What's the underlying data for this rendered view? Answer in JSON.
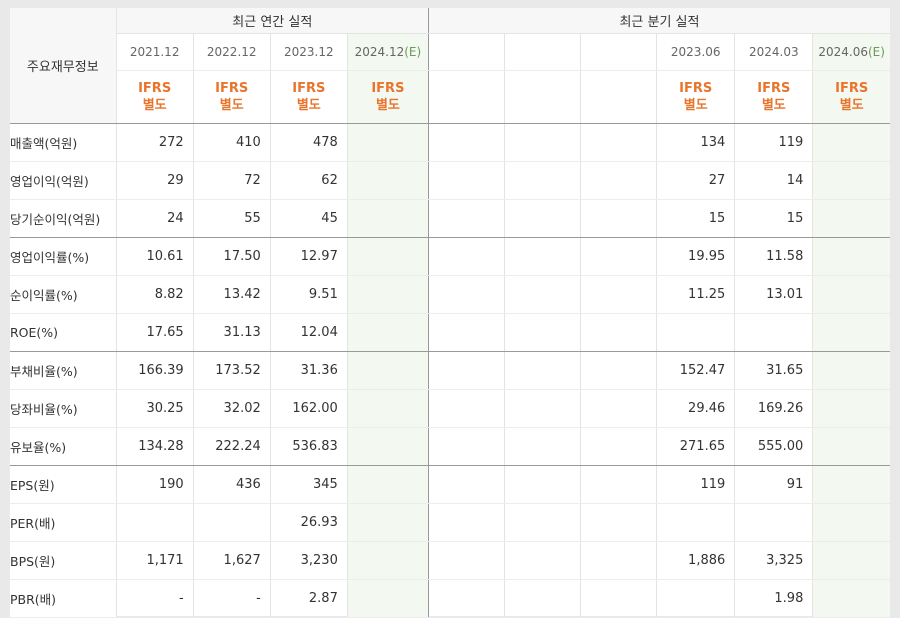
{
  "headers": {
    "row_label": "주요재무정보",
    "annual_group": "최근 연간 실적",
    "quarter_group": "최근 분기 실적",
    "annual_periods": [
      "2021.12",
      "2022.12",
      "2023.12",
      "2024.12"
    ],
    "quarter_periods": [
      "",
      "",
      "",
      "2023.06",
      "2024.03",
      "2024.06"
    ],
    "estimate_tag": "(E)",
    "ifrs_line1": "IFRS",
    "ifrs_line2": "별도"
  },
  "rows": [
    {
      "label": "매출액(억원)",
      "annual": [
        "272",
        "410",
        "478",
        ""
      ],
      "quarter": [
        "",
        "",
        "",
        "134",
        "119",
        ""
      ]
    },
    {
      "label": "영업이익(억원)",
      "annual": [
        "29",
        "72",
        "62",
        ""
      ],
      "quarter": [
        "",
        "",
        "",
        "27",
        "14",
        ""
      ]
    },
    {
      "label": "당기순이익(억원)",
      "annual": [
        "24",
        "55",
        "45",
        ""
      ],
      "quarter": [
        "",
        "",
        "",
        "15",
        "15",
        ""
      ]
    },
    {
      "label": "영업이익률(%)",
      "annual": [
        "10.61",
        "17.50",
        "12.97",
        ""
      ],
      "quarter": [
        "",
        "",
        "",
        "19.95",
        "11.58",
        ""
      ]
    },
    {
      "label": "순이익률(%)",
      "annual": [
        "8.82",
        "13.42",
        "9.51",
        ""
      ],
      "quarter": [
        "",
        "",
        "",
        "11.25",
        "13.01",
        ""
      ]
    },
    {
      "label": "ROE(%)",
      "annual": [
        "17.65",
        "31.13",
        "12.04",
        ""
      ],
      "quarter": [
        "",
        "",
        "",
        "",
        "",
        ""
      ]
    },
    {
      "label": "부채비율(%)",
      "annual": [
        "166.39",
        "173.52",
        "31.36",
        ""
      ],
      "quarter": [
        "",
        "",
        "",
        "152.47",
        "31.65",
        ""
      ]
    },
    {
      "label": "당좌비율(%)",
      "annual": [
        "30.25",
        "32.02",
        "162.00",
        ""
      ],
      "quarter": [
        "",
        "",
        "",
        "29.46",
        "169.26",
        ""
      ]
    },
    {
      "label": "유보율(%)",
      "annual": [
        "134.28",
        "222.24",
        "536.83",
        ""
      ],
      "quarter": [
        "",
        "",
        "",
        "271.65",
        "555.00",
        ""
      ]
    },
    {
      "label": "EPS(원)",
      "annual": [
        "190",
        "436",
        "345",
        ""
      ],
      "quarter": [
        "",
        "",
        "",
        "119",
        "91",
        ""
      ]
    },
    {
      "label": "PER(배)",
      "annual": [
        "",
        "",
        "26.93",
        ""
      ],
      "quarter": [
        "",
        "",
        "",
        "",
        "",
        ""
      ]
    },
    {
      "label": "BPS(원)",
      "annual": [
        "1,171",
        "1,627",
        "3,230",
        ""
      ],
      "quarter": [
        "",
        "",
        "",
        "1,886",
        "3,325",
        ""
      ]
    },
    {
      "label": "PBR(배)",
      "annual": [
        "-",
        "-",
        "2.87",
        ""
      ],
      "quarter": [
        "",
        "",
        "",
        "",
        "1.98",
        ""
      ]
    }
  ],
  "colors": {
    "ifrs": "#e9742c",
    "estimate_bg": "#f3f8f1",
    "estimate_tag": "#6a9a5c"
  }
}
